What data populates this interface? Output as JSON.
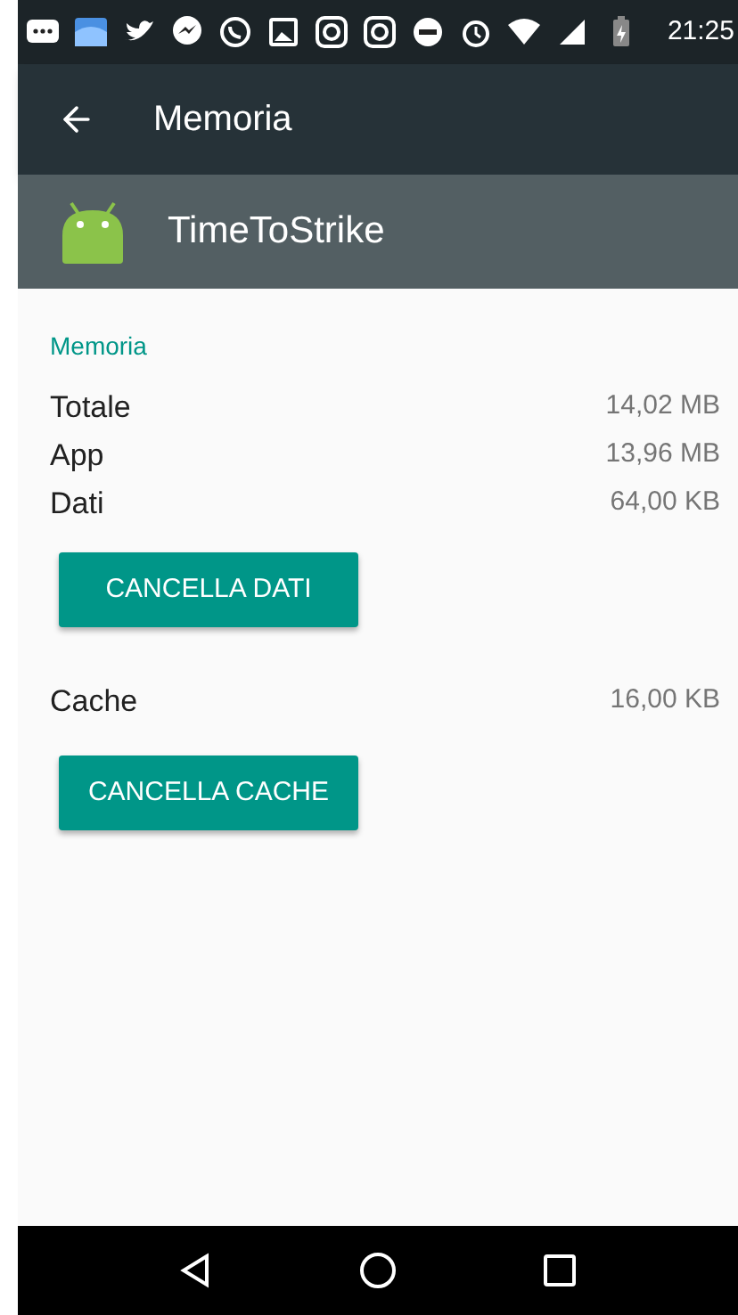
{
  "status_bar": {
    "time": "21:25"
  },
  "toolbar": {
    "title": "Memoria"
  },
  "app_header": {
    "name": "TimeToStrike"
  },
  "section": {
    "title": "Memoria"
  },
  "storage_rows": [
    {
      "label": "Totale",
      "value": "14,02 MB"
    },
    {
      "label": "App",
      "value": "13,96 MB"
    },
    {
      "label": "Dati",
      "value": "64,00 KB"
    }
  ],
  "clear_data_button": "CANCELLA DATI",
  "cache_row": {
    "label": "Cache",
    "value": "16,00 KB"
  },
  "clear_cache_button": "CANCELLA CACHE"
}
